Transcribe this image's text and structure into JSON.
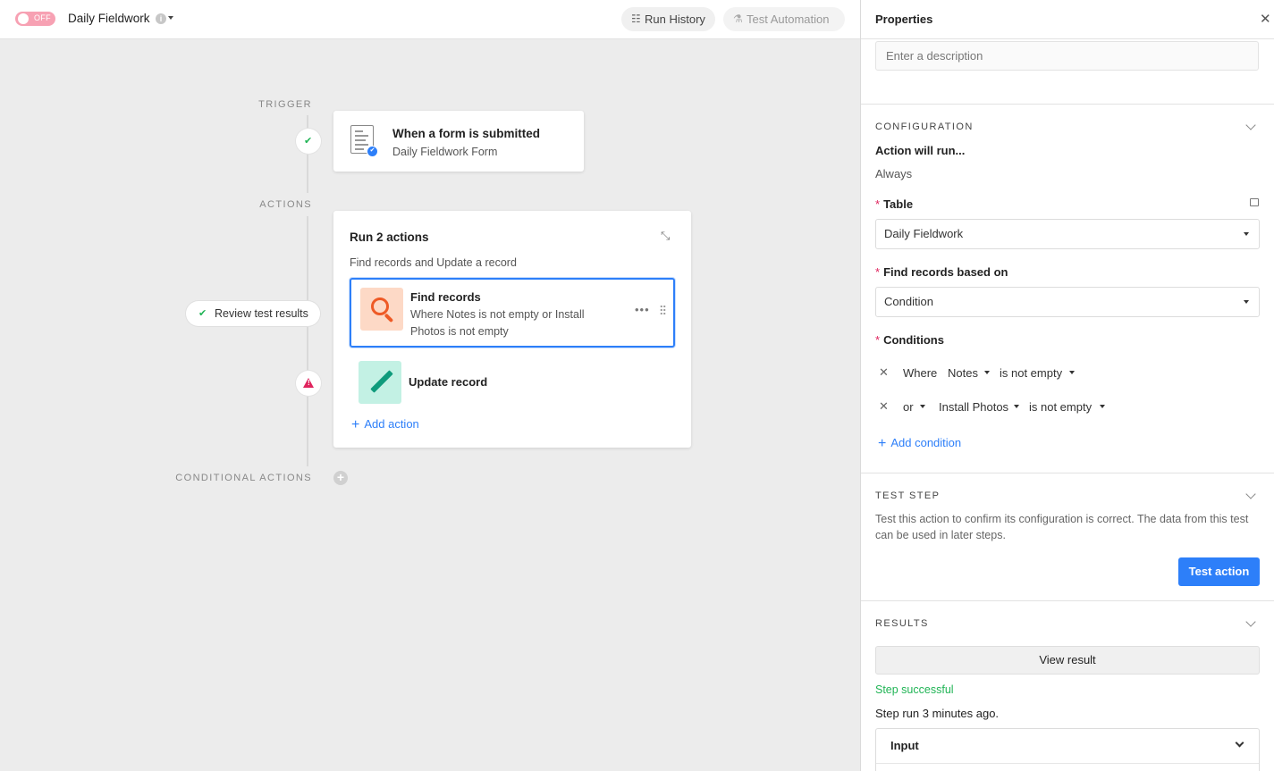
{
  "header": {
    "toggle_label": "OFF",
    "title": "Daily Fieldwork",
    "run_history": "Run History",
    "test_automation": "Test Automation"
  },
  "canvas": {
    "trigger_label": "TRIGGER",
    "actions_label": "ACTIONS",
    "conditional_label": "CONDITIONAL ACTIONS",
    "trigger_card": {
      "title": "When a form is submitted",
      "subtitle": "Daily Fieldwork Form"
    },
    "review_pill": "Review test results",
    "group": {
      "title": "Run 2 actions",
      "subtitle": "Find records and Update a record",
      "actions": [
        {
          "title": "Find records",
          "subtitle": "Where Notes is not empty or Install Photos is not empty",
          "status": "success"
        },
        {
          "title": "Update record",
          "subtitle": "",
          "status": "warning"
        }
      ],
      "add_action": "Add action"
    }
  },
  "panel": {
    "title": "Properties",
    "description_placeholder": "Enter a description",
    "configuration": {
      "heading": "CONFIGURATION",
      "action_will_run": "Action will run...",
      "run_mode": "Always",
      "table_label": "Table",
      "table_value": "Daily Fieldwork",
      "find_label": "Find records based on",
      "find_value": "Condition",
      "conditions_label": "Conditions",
      "conditions": [
        {
          "connector": "Where",
          "field": "Notes",
          "operator": "is not empty"
        },
        {
          "connector": "or",
          "field": "Install Photos",
          "operator": "is not empty"
        }
      ],
      "add_condition": "Add condition"
    },
    "test_step": {
      "heading": "TEST STEP",
      "help": "Test this action to confirm its configuration is correct. The data from this test can be used in later steps.",
      "button": "Test action"
    },
    "results": {
      "heading": "RESULTS",
      "view_result": "View result",
      "status": "Step successful",
      "ran_at": "Step run 3 minutes ago.",
      "input_label": "Input"
    }
  },
  "colors": {
    "accent": "#2d7ff9",
    "success": "#20b455",
    "warning": "#e0245e",
    "toggle_off": "#f7a1b3"
  },
  "icons": {
    "history": "list-icon",
    "test": "flask-icon",
    "trigger": "form-icon",
    "find": "search-icon",
    "update": "pencil-icon"
  }
}
